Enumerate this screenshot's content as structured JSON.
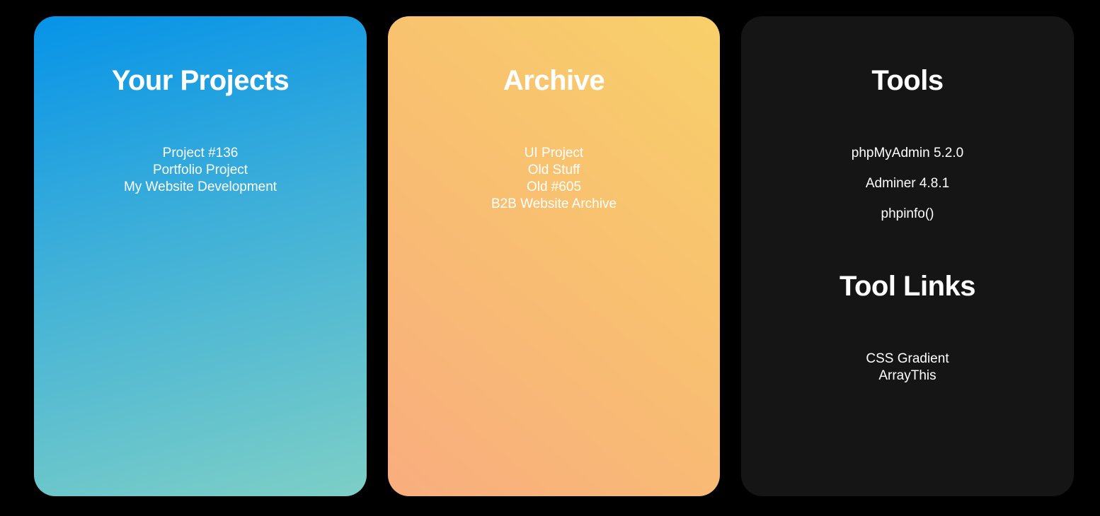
{
  "projects": {
    "title": "Your Projects",
    "items": [
      "Project #136",
      "Portfolio Project",
      "My Website Development"
    ]
  },
  "archive": {
    "title": "Archive",
    "items": [
      "UI Project",
      "Old Stuff",
      "Old #605",
      "B2B Website Archive"
    ]
  },
  "tools": {
    "title": "Tools",
    "items": [
      "phpMyAdmin 5.2.0",
      "Adminer 4.8.1",
      "phpinfo()"
    ],
    "links_title": "Tool Links",
    "links": [
      "CSS Gradient",
      "ArrayThis"
    ]
  },
  "colors": {
    "background": "#000000",
    "projects_gradient_start": "#0693e8",
    "projects_gradient_end": "#7dcfc6",
    "archive_gradient_start": "#f8d06a",
    "archive_gradient_end": "#f9ad7f",
    "tools_card": "#151515",
    "text": "#ffffff"
  }
}
